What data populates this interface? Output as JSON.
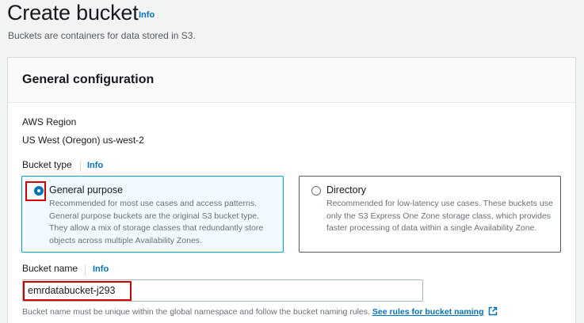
{
  "header": {
    "title": "Create bucket",
    "info_label": "Info",
    "description": "Buckets are containers for data stored in S3."
  },
  "general_config": {
    "title": "General configuration",
    "region": {
      "label": "AWS Region",
      "value": "US West (Oregon) us-west-2"
    },
    "bucket_type": {
      "label": "Bucket type",
      "info_label": "Info",
      "selected": "General purpose",
      "options": [
        {
          "title": "General purpose",
          "description": "Recommended for most use cases and access patterns. General purpose buckets are the original S3 bucket type. They allow a mix of storage classes that redundantly store objects across multiple Availability Zones."
        },
        {
          "title": "Directory",
          "description": "Recommended for low-latency use cases. These buckets use only the S3 Express One Zone storage class, which provides faster processing of data within a single Availability Zone."
        }
      ]
    },
    "bucket_name": {
      "label": "Bucket name",
      "info_label": "Info",
      "value": "emrdatabucket-j293",
      "help_text": "Bucket name must be unique within the global namespace and follow the bucket naming rules.",
      "rules_link": "See rules for bucket naming"
    }
  },
  "colors": {
    "link": "#0073bb",
    "selected_tile_bg": "#f1faff",
    "selected_tile_border": "#00a1c9",
    "highlight": "#d40000"
  },
  "icons": {
    "external_link": "external-link-icon"
  }
}
